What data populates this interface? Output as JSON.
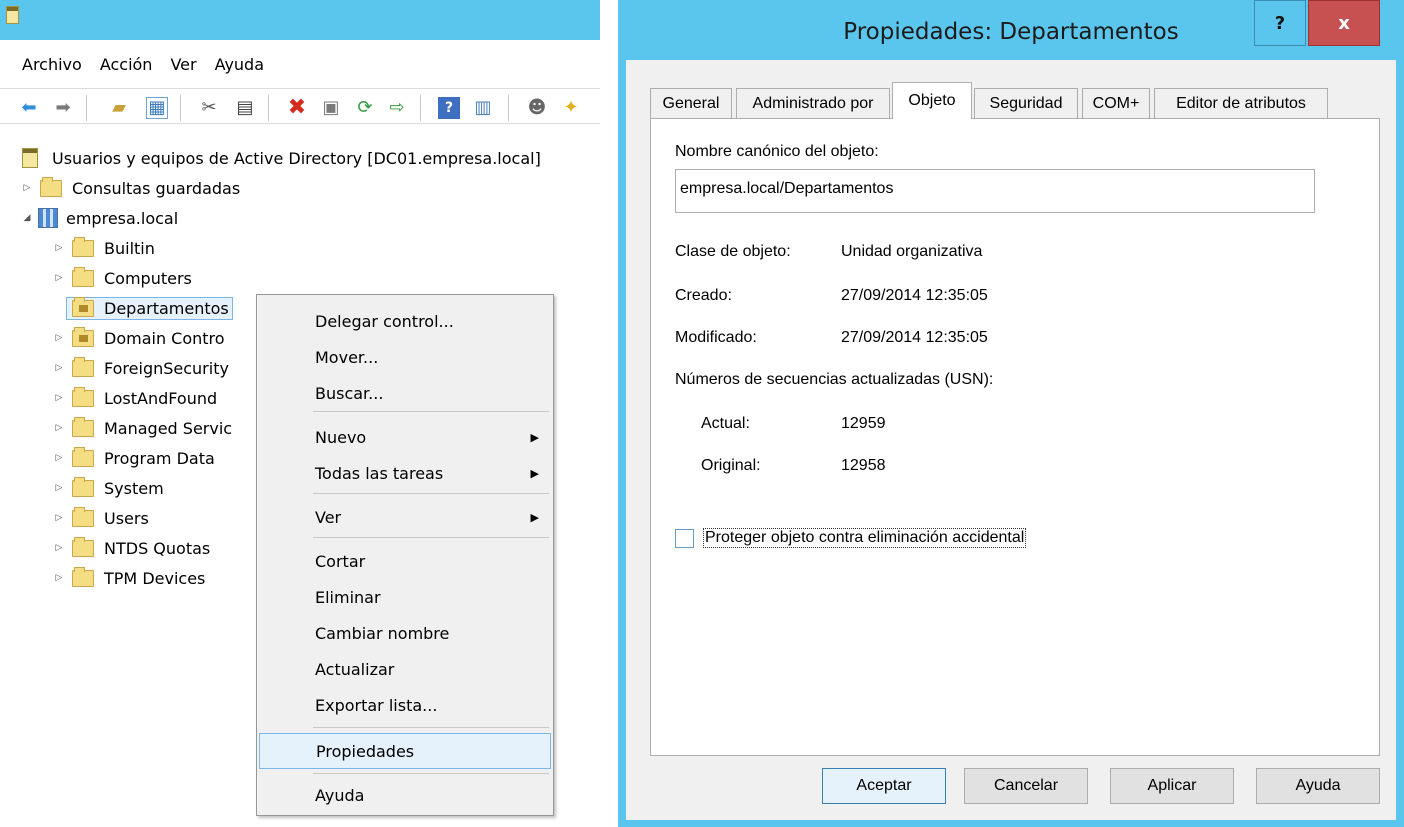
{
  "console": {
    "menu": [
      "Archivo",
      "Acción",
      "Ver",
      "Ayuda"
    ],
    "tree": {
      "root": "Usuarios y equipos de Active Directory [DC01.empresa.local]",
      "saved_queries": "Consultas guardadas",
      "domain": "empresa.local",
      "children": [
        "Builtin",
        "Computers",
        "Departamentos",
        "Domain Contro",
        "ForeignSecurity",
        "LostAndFound",
        "Managed Servic",
        "Program Data",
        "System",
        "Users",
        "NTDS Quotas",
        "TPM Devices"
      ]
    },
    "context_menu": {
      "items": [
        "Delegar control...",
        "Mover...",
        "Buscar...",
        "Nuevo",
        "Todas las tareas",
        "Ver",
        "Cortar",
        "Eliminar",
        "Cambiar nombre",
        "Actualizar",
        "Exportar lista...",
        "Propiedades",
        "Ayuda"
      ],
      "highlighted": "Propiedades"
    }
  },
  "dialog": {
    "title": "Propiedades: Departamentos",
    "help_glyph": "?",
    "close_glyph": "x",
    "tabs": [
      "General",
      "Administrado por",
      "Objeto",
      "Seguridad",
      "COM+",
      "Editor de atributos"
    ],
    "active_tab": "Objeto",
    "canonical_name_label": "Nombre canónico del objeto:",
    "canonical_name_value": "empresa.local/Departamentos",
    "object_class_label": "Clase de objeto:",
    "object_class_value": "Unidad organizativa",
    "created_label": "Creado:",
    "created_value": "27/09/2014 12:35:05",
    "modified_label": "Modificado:",
    "modified_value": "27/09/2014 12:35:05",
    "usn_label": "Números de secuencias actualizadas (USN):",
    "usn_current_label": "Actual:",
    "usn_current_value": "12959",
    "usn_original_label": "Original:",
    "usn_original_value": "12958",
    "protect_label": "Proteger objeto contra eliminación accidental",
    "protect_checked": false,
    "buttons": {
      "ok": "Aceptar",
      "cancel": "Cancelar",
      "apply": "Aplicar",
      "help": "Ayuda"
    }
  }
}
